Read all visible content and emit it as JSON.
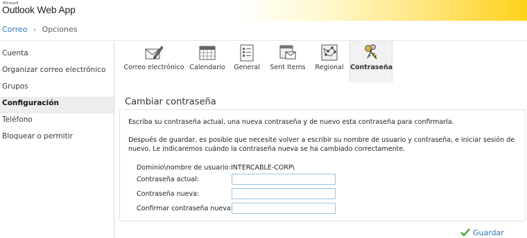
{
  "app": {
    "brand_small": "Microsoft",
    "brand_name": "Outlook Web App"
  },
  "breadcrumb": {
    "root": "Correo",
    "current": "Opciones"
  },
  "sidebar": {
    "items": [
      {
        "label": "Cuenta"
      },
      {
        "label": "Organizar correo electrónico"
      },
      {
        "label": "Grupos"
      },
      {
        "label": "Configuración",
        "active": true
      },
      {
        "label": "Teléfono"
      },
      {
        "label": "Bloquear o permitir"
      }
    ]
  },
  "tabs": [
    {
      "label": "Correo electrónico",
      "icon": "mail-pen-icon"
    },
    {
      "label": "Calendario",
      "icon": "calendar-icon"
    },
    {
      "label": "General",
      "icon": "general-settings-icon"
    },
    {
      "label": "Sent Items",
      "icon": "sent-items-icon"
    },
    {
      "label": "Regional",
      "icon": "regional-map-icon"
    },
    {
      "label": "Contraseña",
      "icon": "keys-icon",
      "active": true
    }
  ],
  "section": {
    "title": "Cambiar contraseña",
    "intro": "Escriba su contraseña actual, una nueva contraseña y de nuevo esta contraseña para confirmarla.",
    "note_line1": "Después de guardar, es posible que necesite volver a escribir su nombre de usuario y contraseña, e iniciar sesión de",
    "note_line2": "nuevo. Le indicaremos cuándo la contraseña nueva se ha cambiado correctamente."
  },
  "form": {
    "domain_label": "Dominio\\nombre de usuario:",
    "domain_value": "INTERCABLE-CORP\\",
    "current_label": "Contraseña actual:",
    "current_value": "",
    "new_label": "Contraseña nueva:",
    "new_value": "",
    "confirm_label": "Confirmar contraseña nueva:",
    "confirm_value": ""
  },
  "actions": {
    "save_label": "Guardar"
  },
  "colors": {
    "link": "#2d72b8",
    "save_check": "#3aa02b",
    "input_border": "#9cc2e3",
    "header_accent": "#ffd11a"
  }
}
